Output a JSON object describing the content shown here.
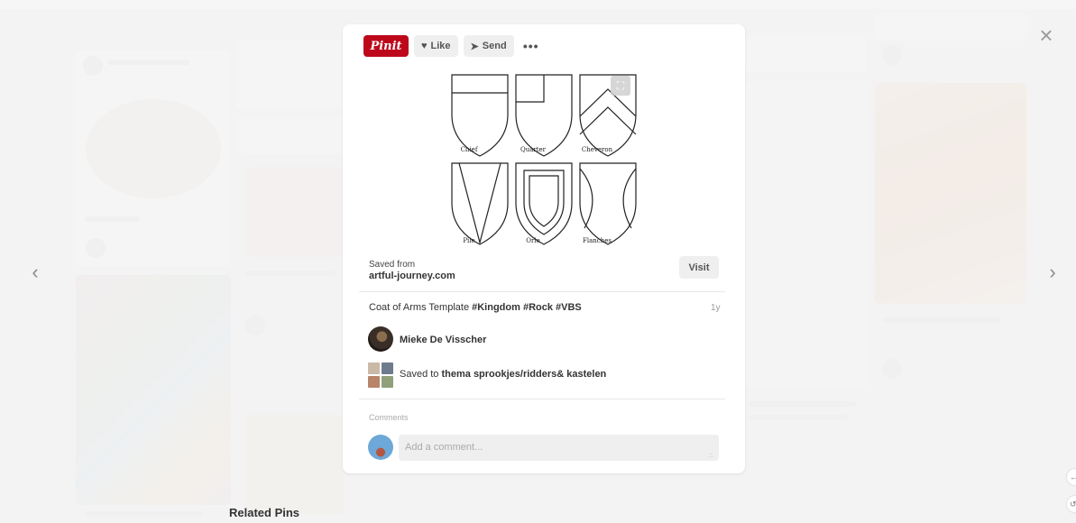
{
  "toolbar": {
    "pin_label": "Pinit",
    "like_label": "Like",
    "send_label": "Send",
    "more_label": "•••"
  },
  "pin": {
    "shield_labels": [
      "Chief",
      "Quarter",
      "Cheveron",
      "Pile",
      "Orle",
      "Flanches"
    ]
  },
  "source": {
    "saved_from_label": "Saved from",
    "site": "artful-journey.com",
    "visit_label": "Visit"
  },
  "description": {
    "text": "Coat of Arms Template ",
    "tags": "#Kingdom #Rock #VBS",
    "age": "1y"
  },
  "pinner": {
    "name": "Mieke De Visscher"
  },
  "board": {
    "prefix": "Saved to ",
    "name": "thema sprookjes/ridders& kastelen"
  },
  "comments": {
    "label": "Comments",
    "placeholder": "Add a comment..."
  },
  "page": {
    "related_label": "Related Pins"
  },
  "icons": {
    "prev": "chevron-left-icon",
    "next": "chevron-right-icon",
    "close": "close-icon"
  },
  "colors": {
    "pin_red": "#bd081c",
    "backdrop": "#ececec"
  }
}
